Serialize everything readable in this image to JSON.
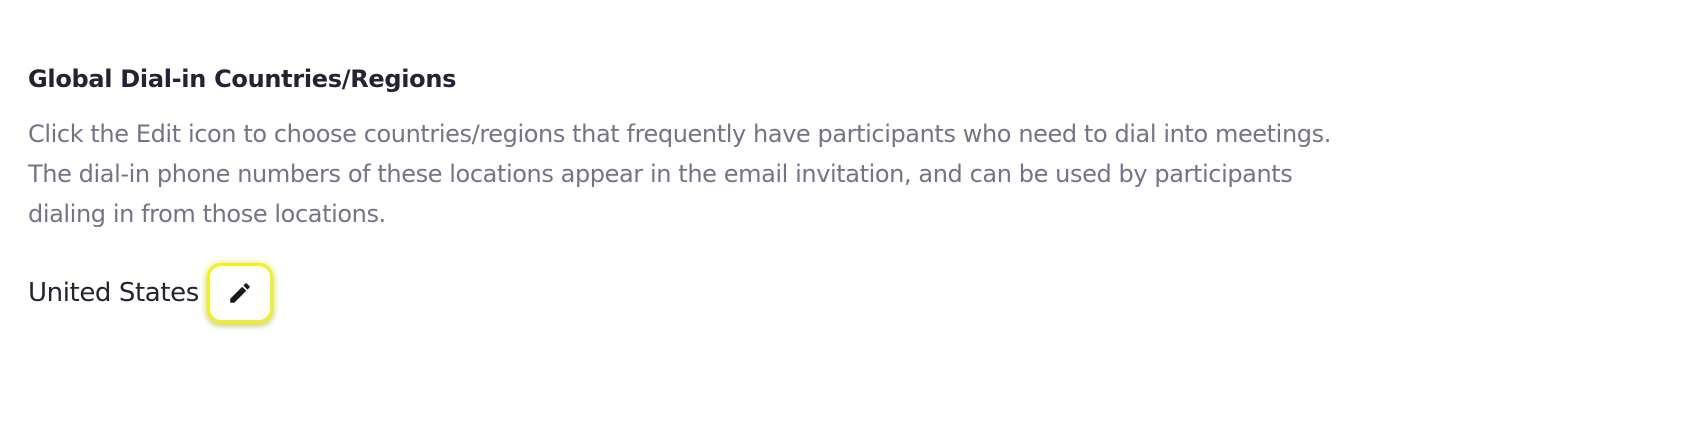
{
  "section": {
    "title": "Global Dial-in Countries/Regions",
    "description_lines": [
      "Click the Edit icon to choose countries/regions that frequently have participants who need to dial into meetings.",
      "The dial-in phone numbers of these locations appear in the email invitation, and can be used by participants",
      "dialing in from those locations."
    ],
    "selected_country": "United States",
    "edit_icon": "pencil-icon"
  },
  "colors": {
    "title": "#232333",
    "description": "#747487",
    "highlight": "#f0f02a"
  }
}
